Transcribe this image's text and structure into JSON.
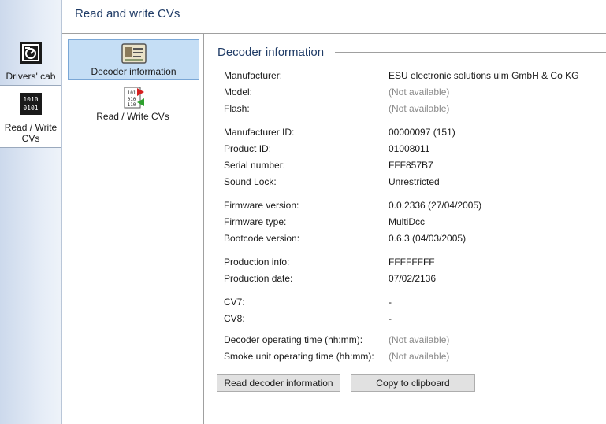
{
  "nav": {
    "items": [
      {
        "label": "Drivers' cab",
        "icon": "drivers-cab-icon"
      },
      {
        "label": "Read / Write CVs",
        "icon": "binary-icon"
      }
    ]
  },
  "header": {
    "title": "Read and write CVs"
  },
  "subnav": {
    "items": [
      {
        "label": "Decoder information",
        "icon": "id-card-icon"
      },
      {
        "label": "Read / Write CVs",
        "icon": "cv-readwrite-icon"
      }
    ]
  },
  "section": {
    "title": "Decoder information"
  },
  "info": [
    {
      "key": "Manufacturer:",
      "value": "ESU electronic solutions ulm GmbH & Co KG"
    },
    {
      "key": "Model:",
      "value": "(Not available)"
    },
    {
      "key": "Flash:",
      "value": "(Not available)"
    },
    {
      "key": "Manufacturer ID:",
      "value": "00000097 (151)"
    },
    {
      "key": "Product ID:",
      "value": "01008011"
    },
    {
      "key": "Serial number:",
      "value": "FFF857B7"
    },
    {
      "key": "Sound Lock:",
      "value": "Unrestricted"
    },
    {
      "key": "Firmware version:",
      "value": "0.0.2336 (27/04/2005)"
    },
    {
      "key": "Firmware type:",
      "value": "MultiDcc"
    },
    {
      "key": "Bootcode version:",
      "value": "0.6.3 (04/03/2005)"
    },
    {
      "key": "Production info:",
      "value": "FFFFFFFF"
    },
    {
      "key": "Production date:",
      "value": "07/02/2136"
    },
    {
      "key": "CV7:",
      "value": "-"
    },
    {
      "key": "CV8:",
      "value": "-"
    },
    {
      "key": "Decoder operating time (hh:mm):",
      "value": "(Not available)"
    },
    {
      "key": "Smoke unit operating time (hh:mm):",
      "value": "(Not available)"
    }
  ],
  "buttons": {
    "read": "Read decoder information",
    "copy": "Copy to clipboard"
  },
  "colors": {
    "accent_title": "#1f3b66",
    "selection": "#c5def5",
    "not_available": "#8a8a8a"
  }
}
